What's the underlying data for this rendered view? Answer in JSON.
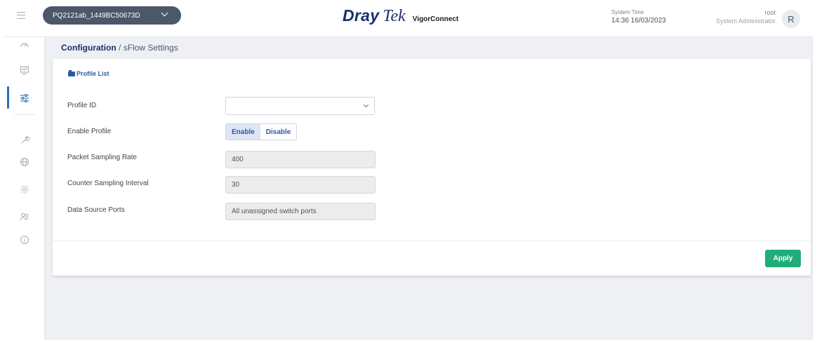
{
  "header": {
    "device_name": "PQ2121ab_1449BC50673D",
    "brand_primary": "Dray",
    "brand_secondary": "Tek",
    "brand_product": "VigorConnect",
    "system_time_label": "System Time",
    "system_time_value": "14:36 16/03/2023",
    "user_name": "root",
    "user_role": "System Administrator",
    "avatar_letter": "R"
  },
  "sidebar": {
    "items": [
      {
        "icon": "dashboard-icon",
        "active": false
      },
      {
        "icon": "monitor-icon",
        "active": false
      },
      {
        "icon": "configuration-icon",
        "active": true
      },
      {
        "icon": "maintenance-icon",
        "active": false
      },
      {
        "icon": "network-icon",
        "active": false
      },
      {
        "icon": "settings-icon",
        "active": false
      },
      {
        "icon": "users-icon",
        "active": false
      },
      {
        "icon": "info-icon",
        "active": false
      }
    ]
  },
  "breadcrumb": {
    "section": "Configuration",
    "separator": "/",
    "page": "sFlow Settings"
  },
  "card": {
    "title": "Profile List"
  },
  "form": {
    "profile_id_label": "Profile ID",
    "profile_id_value": "",
    "enable_profile_label": "Enable Profile",
    "enable_option": "Enable",
    "disable_option": "Disable",
    "enable_selected": "Enable",
    "sampling_rate_label": "Packet Sampling Rate",
    "sampling_rate_value": "400",
    "counter_interval_label": "Counter Sampling Interval",
    "counter_interval_value": "30",
    "data_source_label": "Data Source Ports",
    "data_source_value": "All unassigned switch ports"
  },
  "actions": {
    "apply_label": "Apply"
  },
  "colors": {
    "accent": "#2a5aa8",
    "brand": "#1a2f6b",
    "apply": "#1fae7a",
    "device_pill": "#4a5868"
  }
}
